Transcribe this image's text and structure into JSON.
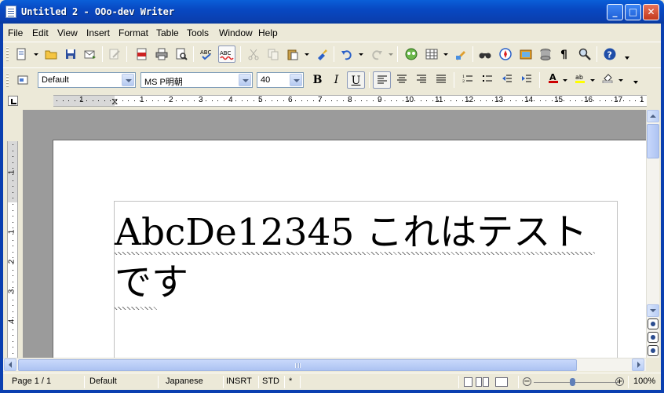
{
  "window": {
    "title": "Untitled 2 - OOo-dev Writer",
    "min_label": "_",
    "max_label": "□",
    "close_label": "✕"
  },
  "menu": [
    "File",
    "Edit",
    "View",
    "Insert",
    "Format",
    "Table",
    "Tools",
    "Window",
    "Help"
  ],
  "format_toolbar": {
    "style": "Default",
    "font": "MS P明朝",
    "size": "40",
    "bold": "B",
    "italic": "I",
    "underline": "U"
  },
  "ruler": {
    "h_labels": [
      "1",
      "1",
      "2",
      "3",
      "4",
      "5",
      "6",
      "7",
      "8",
      "9",
      "10",
      "11",
      "12",
      "13",
      "14",
      "15",
      "16",
      "17",
      "1"
    ],
    "v_labels": [
      "1",
      "1",
      "2",
      "3",
      "4"
    ]
  },
  "document": {
    "text": "AbcDe12345 これはテストです"
  },
  "statusbar": {
    "page": "Page 1 / 1",
    "style": "Default",
    "language": "Japanese",
    "insert_mode": "INSRT",
    "selection_mode": "STD",
    "modified": "*",
    "zoom": "100%"
  },
  "colors": {
    "titlebar": "#0a48c2",
    "chrome": "#ece9d8",
    "workspace": "#9b9b9b"
  },
  "icons": [
    "new-document-icon",
    "open-folder-icon",
    "save-icon",
    "email-icon",
    "edit-file-icon",
    "export-pdf-icon",
    "print-icon",
    "page-preview-icon",
    "spellcheck-icon",
    "autospellcheck-icon",
    "cut-icon",
    "copy-icon",
    "paste-icon",
    "clone-format-icon",
    "undo-icon",
    "redo-icon",
    "navigator-icon",
    "table-icon",
    "draw-functions-icon",
    "find-replace-icon",
    "navigator-compass-icon",
    "gallery-icon",
    "data-sources-icon",
    "formatting-marks-icon",
    "zoom-icon",
    "help-icon"
  ]
}
